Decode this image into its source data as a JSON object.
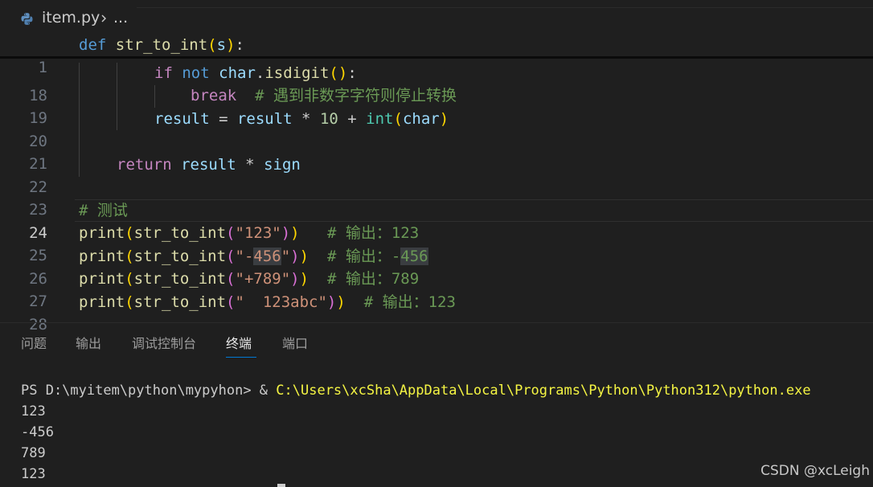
{
  "breadcrumb": {
    "file": "item.py",
    "more": "..."
  },
  "editor": {
    "sticky": {
      "ln": "1",
      "def": "def",
      "name": "str_to_int",
      "open": "(",
      "param": "s",
      "close": ")",
      "colon": ":"
    },
    "lines": {
      "l18": {
        "ln": "18",
        "if": "if",
        "not": "not",
        "obj": "char",
        "dot": ".",
        "method": "isdigit",
        "open": "(",
        "close": ")",
        "colon": ":"
      },
      "l19": {
        "ln": "19",
        "kw": "break",
        "comment": "# 遇到非数字字符则停止转换"
      },
      "l20": {
        "ln": "20",
        "lhs": "result",
        "eq": " = ",
        "rhs": "result",
        "mul": " * ",
        "num": "10",
        "plus": " + ",
        "fn": "int",
        "open": "(",
        "arg": "char",
        "close": ")"
      },
      "l21": {
        "ln": "21"
      },
      "l22": {
        "ln": "22",
        "kw": "return",
        "a": "result",
        "mul": " * ",
        "b": "sign"
      },
      "l23": {
        "ln": "23"
      },
      "l24": {
        "ln": "24",
        "comment": "# 测试"
      },
      "l25": {
        "ln": "25",
        "print": "print",
        "o1": "(",
        "fn": "str_to_int",
        "o2": "(",
        "str": "\"123\"",
        "c2": ")",
        "c1": ")",
        "comment": "# 输出：123"
      },
      "l26": {
        "ln": "26",
        "print": "print",
        "o1": "(",
        "fn": "str_to_int",
        "o2": "(",
        "str_a": "\"-",
        "str_b": "456",
        "str_c": "\"",
        "c2": ")",
        "c1": ")",
        "comment_a": "# 输出：-",
        "comment_b": "456"
      },
      "l27": {
        "ln": "27",
        "print": "print",
        "o1": "(",
        "fn": "str_to_int",
        "o2": "(",
        "str": "\"+789\"",
        "c2": ")",
        "c1": ")",
        "comment": "# 输出：789"
      },
      "l28": {
        "ln": "28",
        "print": "print",
        "o1": "(",
        "fn": "str_to_int",
        "o2": "(",
        "str": "\"  123abc\"",
        "c2": ")",
        "c1": ")",
        "comment": "# 输出：123"
      }
    }
  },
  "panel": {
    "tabs": [
      "问题",
      "输出",
      "调试控制台",
      "终端",
      "端口"
    ],
    "active_tab": "终端",
    "terminal": {
      "prompt": "PS D:\\myitem\\python\\mypyhon> & ",
      "command": "C:\\Users\\xcSha\\AppData\\Local\\Programs\\Python\\Python312\\python.exe",
      "output": [
        "123",
        "-456",
        "789",
        "123"
      ]
    }
  },
  "watermark": "CSDN @xcLeigh",
  "colors": {
    "background": "#1f1f1f",
    "keyword": "#569cd6",
    "control_keyword": "#c586c0",
    "function": "#dcdcaa",
    "variable": "#9cdcfe",
    "string": "#ce9178",
    "number": "#b5cea8",
    "comment": "#6a9955",
    "terminal_command": "#f5f543",
    "active_tab_underline": "#0078d4"
  },
  "icons": {
    "file": "python-file-icon",
    "separator": "chevron-right-icon"
  }
}
